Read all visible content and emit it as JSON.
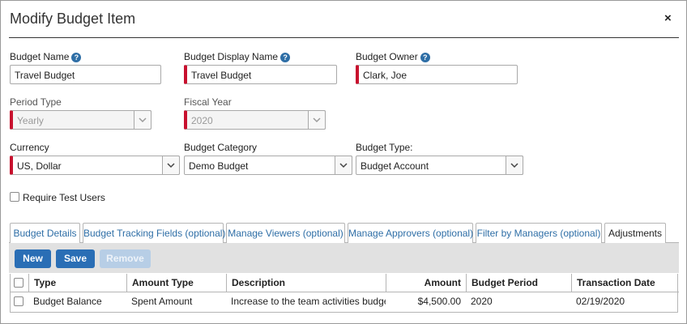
{
  "dialog": {
    "title": "Modify Budget Item",
    "close_glyph": "×"
  },
  "form": {
    "budget_name": {
      "label": "Budget Name",
      "value": "Travel Budget"
    },
    "budget_display_name": {
      "label": "Budget Display Name",
      "value": "Travel Budget"
    },
    "budget_owner": {
      "label": "Budget Owner",
      "value": "Clark, Joe"
    },
    "period_type": {
      "label": "Period Type",
      "value": "Yearly"
    },
    "fiscal_year": {
      "label": "Fiscal Year",
      "value": "2020"
    },
    "currency": {
      "label": "Currency",
      "value": "US, Dollar"
    },
    "budget_category": {
      "label": "Budget Category",
      "value": "Demo Budget"
    },
    "budget_type": {
      "label": "Budget Type:",
      "value": "Budget Account"
    },
    "require_test_users": {
      "label": "Require Test Users",
      "checked": false
    },
    "help_glyph": "?"
  },
  "tabs": [
    {
      "label": "Budget Details"
    },
    {
      "label": "Budget Tracking Fields (optional)"
    },
    {
      "label": "Manage Viewers (optional)"
    },
    {
      "label": "Manage Approvers (optional)"
    },
    {
      "label": "Filter by Managers (optional)"
    },
    {
      "label": "Adjustments",
      "active": true
    }
  ],
  "toolbar": {
    "new_label": "New",
    "save_label": "Save",
    "remove_label": "Remove"
  },
  "grid": {
    "columns": [
      "Type",
      "Amount Type",
      "Description",
      "Amount",
      "Budget Period",
      "Transaction Date"
    ],
    "rows": [
      {
        "type": "Budget Balance",
        "amount_type": "Spent Amount",
        "description": "Increase to the team activities budget",
        "amount": "$4,500.00",
        "budget_period": "2020",
        "transaction_date": "02/19/2020"
      }
    ]
  },
  "colors": {
    "accent": "#2a6eb5",
    "required": "#c8102e",
    "link": "#2e6ea6"
  }
}
